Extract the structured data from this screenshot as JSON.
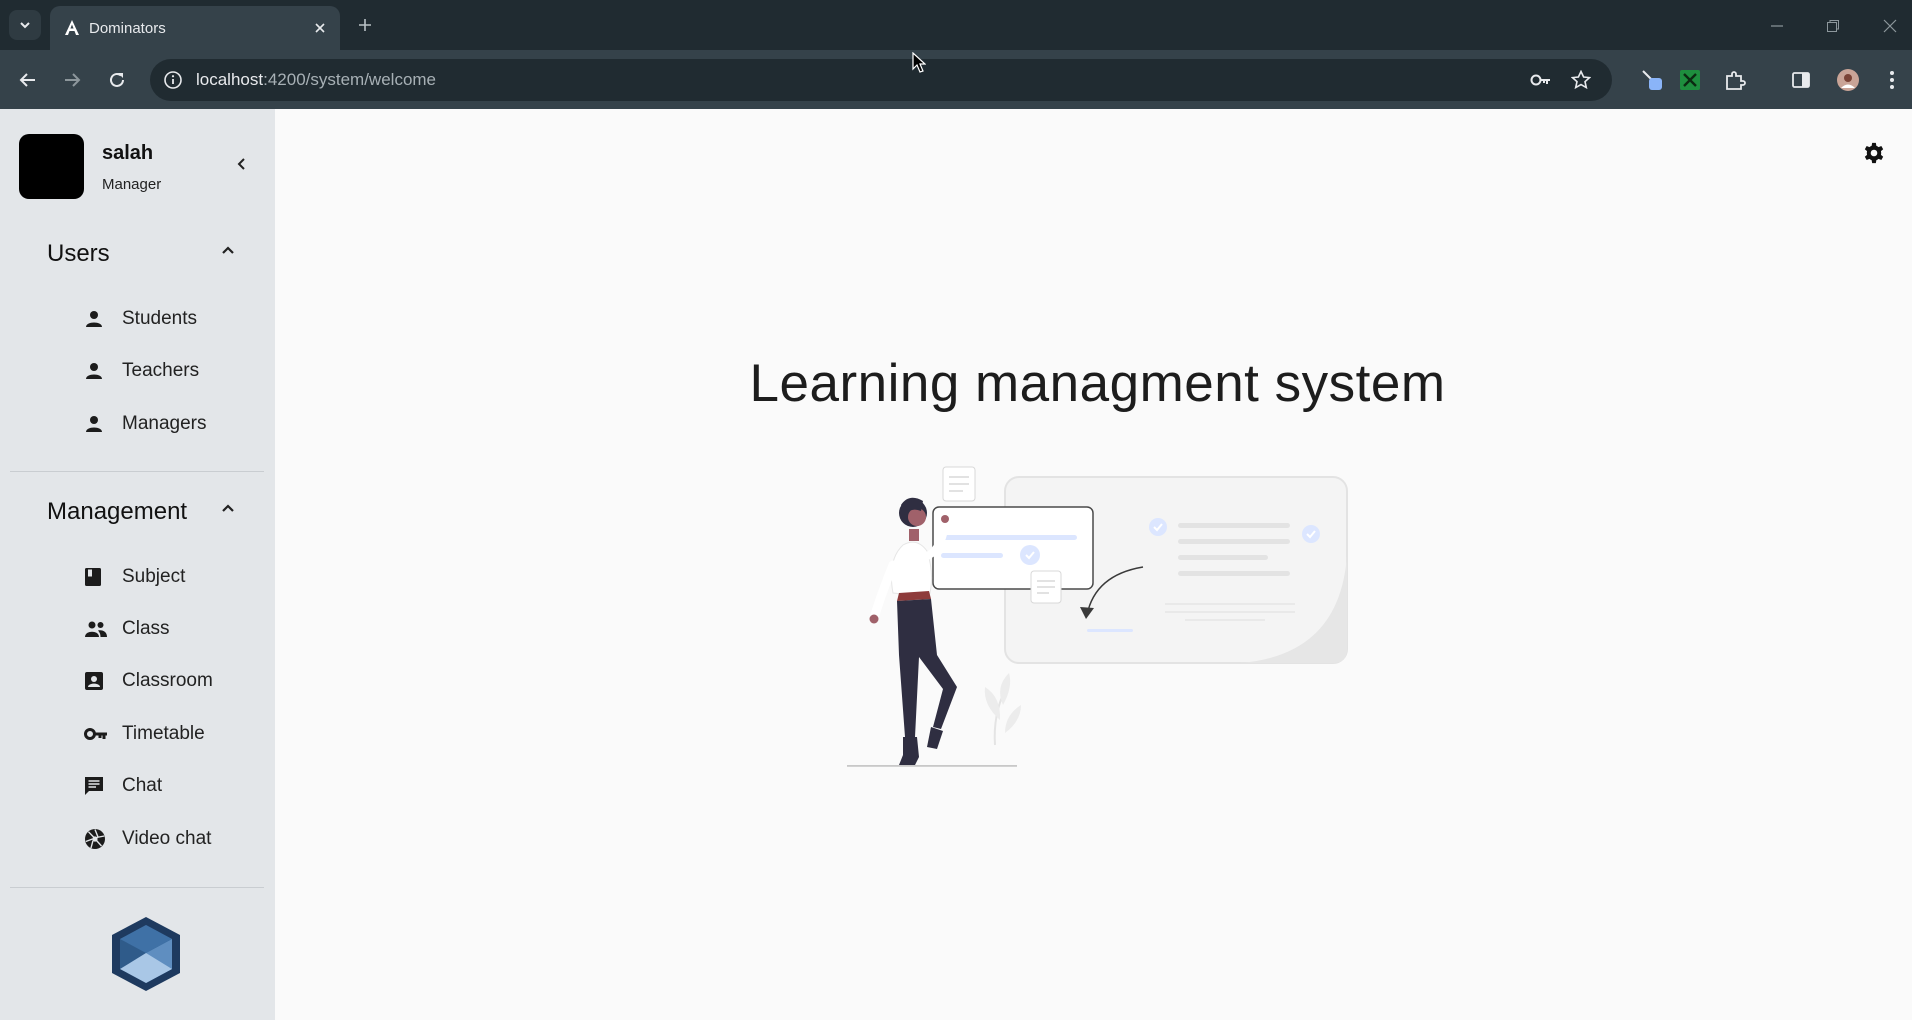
{
  "browser": {
    "tab_title": "Dominators",
    "url_host": "localhost",
    "url_path": ":4200/system/welcome"
  },
  "sidebar": {
    "user": {
      "name": "salah",
      "role": "Manager"
    },
    "sections": [
      {
        "title": "Users",
        "items": [
          {
            "label": "Students",
            "icon": "person-icon"
          },
          {
            "label": "Teachers",
            "icon": "person-icon"
          },
          {
            "label": "Managers",
            "icon": "person-icon"
          }
        ]
      },
      {
        "title": "Management",
        "items": [
          {
            "label": "Subject",
            "icon": "book-icon"
          },
          {
            "label": "Class",
            "icon": "group-icon"
          },
          {
            "label": "Classroom",
            "icon": "contact-card-icon"
          },
          {
            "label": "Timetable",
            "icon": "key-icon"
          },
          {
            "label": "Chat",
            "icon": "chat-icon"
          },
          {
            "label": "Video chat",
            "icon": "camera-shutter-icon"
          }
        ]
      }
    ]
  },
  "main": {
    "headline": "Learning managment system"
  },
  "colors": {
    "tabstrip": "#202b31",
    "toolbar": "#35424a",
    "sidebar": "#e3e6e9",
    "main_bg": "#fafafa",
    "accent_blue": "#c7d6ff"
  }
}
